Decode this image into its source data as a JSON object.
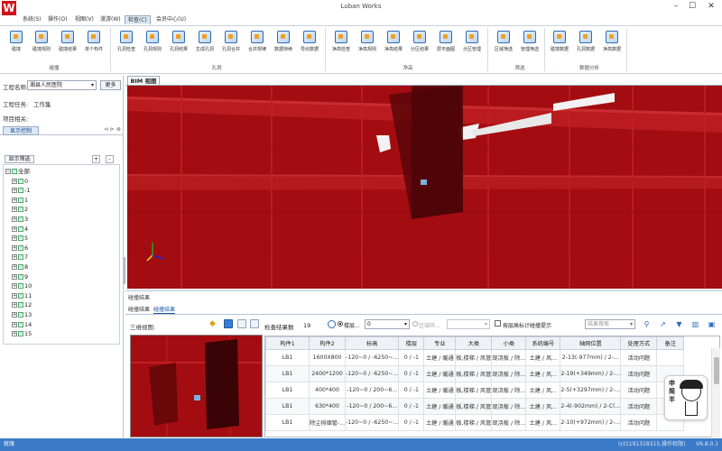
{
  "app": {
    "title": "Luban Works",
    "logo": "W"
  },
  "window_controls": [
    "–",
    "☐",
    "✕"
  ],
  "menu": [
    {
      "label": "系统(S)"
    },
    {
      "label": "操作(O)"
    },
    {
      "label": "视图(V)"
    },
    {
      "label": "漫游(W)"
    },
    {
      "label": "检查(C)",
      "active": true
    },
    {
      "label": "会员中心(U)"
    }
  ],
  "ribbon": {
    "groups": [
      {
        "label": "碰撞",
        "buttons": [
          "碰撞",
          "碰撞规则",
          "碰撞结果",
          "单个构件"
        ]
      },
      {
        "label": "孔洞",
        "buttons": [
          "孔洞检查",
          "孔洞规则",
          "孔洞结果",
          "生成孔洞",
          "孔洞合并",
          "合并规律",
          "数据持续",
          "导出数据"
        ]
      },
      {
        "label": "净高",
        "buttons": [
          "净高检查",
          "净高规则",
          "净高结果",
          "分区结果",
          "层平面图",
          "分区管理"
        ]
      },
      {
        "label": "筛选",
        "buttons": [
          "区域筛选",
          "管理筛选"
        ]
      },
      {
        "label": "数据分析",
        "buttons": [
          "碰撞数据",
          "孔洞数据",
          "净高数据"
        ]
      }
    ]
  },
  "left_panel": {
    "project_label": "工程名称:",
    "project_value": "湘县人民医院",
    "more_button": "更多",
    "task_label": "工程任务:",
    "task_value": "工作集",
    "related_label": "项目相关:",
    "tab_label": "显示控制",
    "tab_controls": "⊲ ⊳ ⊗",
    "filter_tab": "显示筛选",
    "plus": "+",
    "minus": "-",
    "tree": [
      {
        "label": "全部",
        "level": 0
      },
      {
        "label": "0",
        "level": 1
      },
      {
        "label": "-1",
        "level": 1
      },
      {
        "label": "1",
        "level": 1
      },
      {
        "label": "2",
        "level": 1
      },
      {
        "label": "3",
        "level": 1
      },
      {
        "label": "4",
        "level": 1
      },
      {
        "label": "5",
        "level": 1
      },
      {
        "label": "6",
        "level": 1
      },
      {
        "label": "7",
        "level": 1
      },
      {
        "label": "8",
        "level": 1
      },
      {
        "label": "9",
        "level": 1
      },
      {
        "label": "10",
        "level": 1
      },
      {
        "label": "11",
        "level": 1
      },
      {
        "label": "12",
        "level": 1
      },
      {
        "label": "13",
        "level": 1
      },
      {
        "label": "14",
        "level": 1
      },
      {
        "label": "15",
        "level": 1
      }
    ]
  },
  "view_tab": "BIM 视图",
  "results": {
    "title": "碰撞结果",
    "tabs": [
      "碰撞结果",
      "碰撞结果"
    ],
    "view3d_label": "三维视图:",
    "count_label": "检查结果数",
    "count_value": "19",
    "radio_floor": "楼层...",
    "floor_value": "0",
    "radio_area": "区域碎...",
    "checkbox_label": "按层高标计碰撞提示",
    "search_placeholder": "结果搜索",
    "columns": [
      "构件1",
      "构件2",
      "标高",
      "楼层",
      "专业",
      "大类",
      "小类",
      "系统编号",
      "轴网位置",
      "处理方式",
      "备注"
    ],
    "rows": [
      [
        "LB1",
        "1600X800",
        "-120~0 / -6250~...",
        "0 / -1",
        "土建 / 暖通",
        "板,楼梯 / 风管",
        "现浇板 / 除...",
        "土建 / 风...",
        "2-13(-977mm) / 2-...",
        "活动问题",
        ""
      ],
      [
        "LB1",
        "2400*1200",
        "-120~0 / -6250~...",
        "0 / -1",
        "土建 / 暖通",
        "板,楼梯 / 风管",
        "现浇板 / 除...",
        "土建 / 风...",
        "2-19(+349mm) / 2-...",
        "活动问题",
        ""
      ],
      [
        "LB1",
        "400*400",
        "-120~0 / 200~6...",
        "0 / -1",
        "土建 / 暖通",
        "板,楼梯 / 风管",
        "现浇板 / 除...",
        "土建 / 风...",
        "2-5(+3297mm) / 2-...",
        "活动问题",
        ""
      ],
      [
        "LB1",
        "630*400",
        "-120~0 / 200~6...",
        "0 / -1",
        "土建 / 暖通",
        "板,楼梯 / 风管",
        "现浇板 / 除...",
        "土建 / 风...",
        "2-4(-902mm) / 2-C(...",
        "活动问题",
        ""
      ],
      [
        "LB1",
        "除尘排烟管-...",
        "-120~0 / -6250~...",
        "0 / -1",
        "土建 / 暖通",
        "板,楼梯 / 风管",
        "现浇板 / 除...",
        "土建 / 风...",
        "2-10(+972mm) / 2-...",
        "活动问题",
        ""
      ]
    ]
  },
  "mascot_text": "申简半",
  "status": {
    "left": "就绪",
    "user": "(ct1191318315,操作权限)",
    "version": "V6.8.0.1"
  },
  "colors": {
    "accent": "#2d6bb5",
    "viewport_red": "#a50e12",
    "statusbar": "#3c7bc8"
  }
}
